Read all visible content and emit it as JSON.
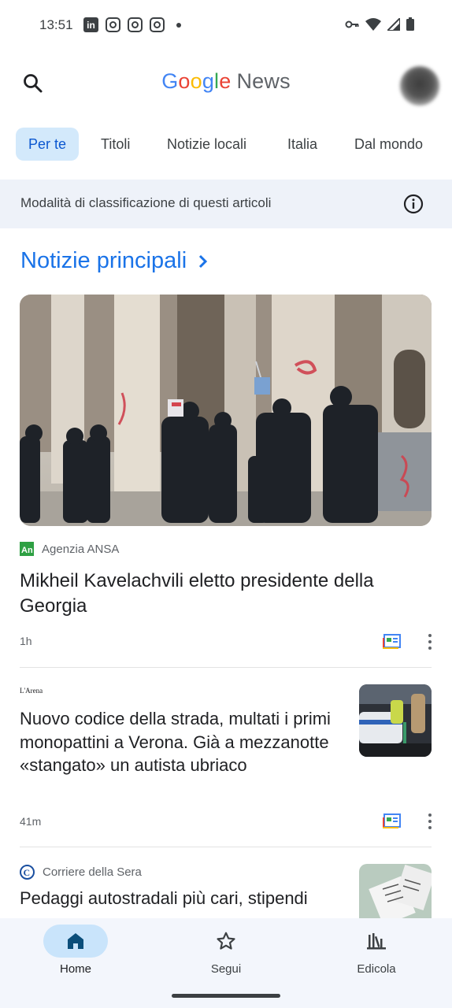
{
  "status_bar": {
    "time": "13:51",
    "app_icons": [
      "linkedin-icon",
      "instagram-icon",
      "instagram-icon",
      "instagram-icon"
    ],
    "indicators": [
      "vpn-key-icon",
      "wifi-icon",
      "signal-icon",
      "battery-icon"
    ]
  },
  "app_bar": {
    "logo": {
      "g1": "G",
      "g2": "o",
      "g3": "o",
      "g4": "g",
      "g5": "l",
      "g6": "e",
      "news": "News"
    }
  },
  "tabs": [
    "Per te",
    "Titoli",
    "Notizie locali",
    "Italia",
    "Dal mondo"
  ],
  "active_tab": "Per te",
  "info_strip": {
    "text": "Modalità di classificazione di questi articoli"
  },
  "section": {
    "title": "Notizie principali"
  },
  "articles": [
    {
      "source": "Agenzia ANSA",
      "title": "Mikheil Kavelachvili eletto presidente della Georgia",
      "time": "1h"
    },
    {
      "source": "L'Arena",
      "title": "Nuovo codice della strada, multati i primi monopattini a Verona. Già a mezzanotte «stangato» un autista ubriaco",
      "time": "41m"
    },
    {
      "source": "Corriere della Sera",
      "title": "Pedaggi autostradali più cari, stipendi"
    }
  ],
  "bottom_nav": [
    {
      "label": "Home",
      "icon": "home-icon",
      "active": true
    },
    {
      "label": "Segui",
      "icon": "star-icon",
      "active": false
    },
    {
      "label": "Edicola",
      "icon": "newsstand-icon",
      "active": false
    }
  ],
  "colors": {
    "accent": "#1a73e8",
    "active_tab_bg": "#d3e9fb",
    "nav_bg": "#f3f6fc",
    "info_bg": "#eef2f9"
  }
}
